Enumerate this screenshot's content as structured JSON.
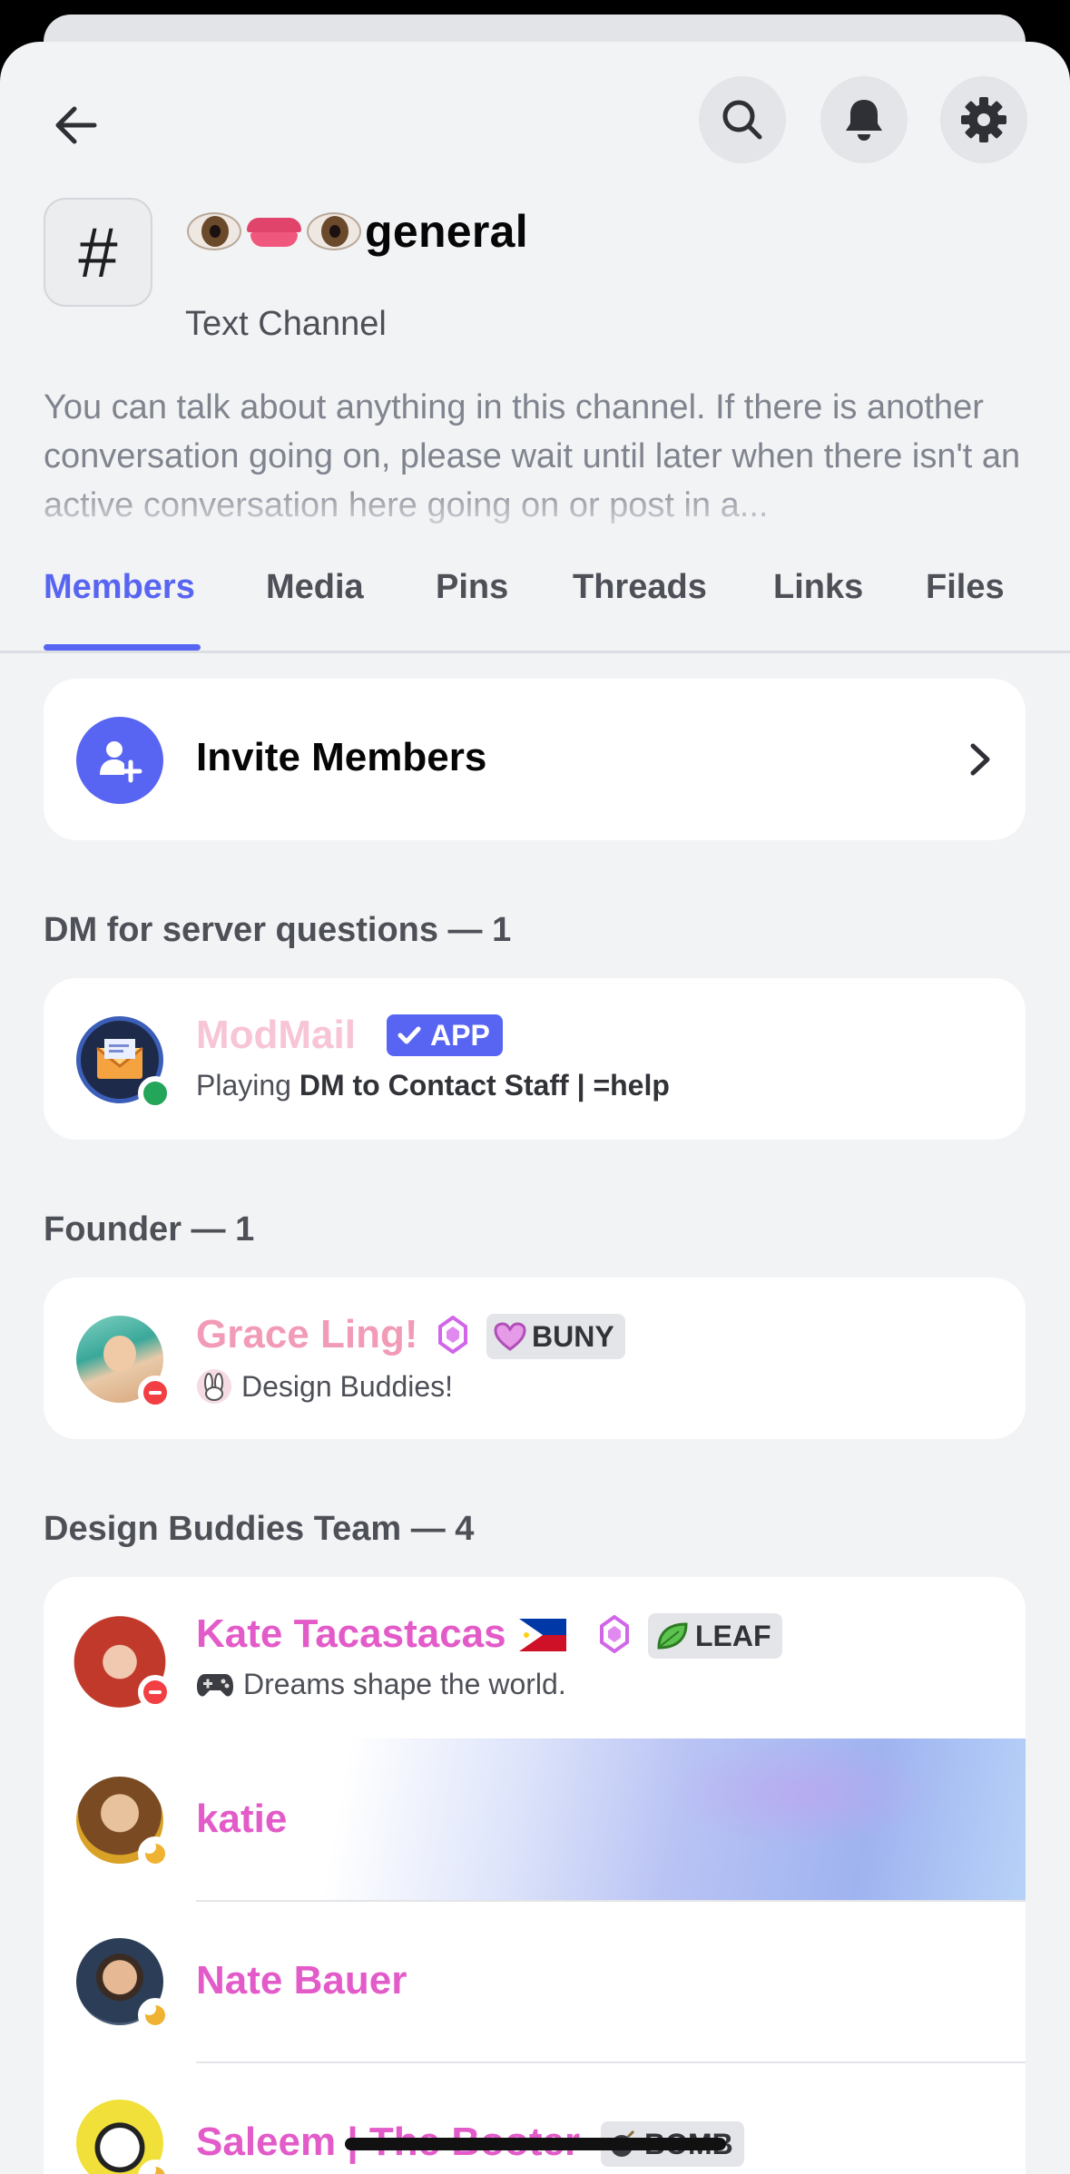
{
  "header": {
    "back_icon": "arrow-left-icon",
    "actions": [
      "search-icon",
      "bell-icon",
      "gear-icon"
    ]
  },
  "channel": {
    "hash_glyph": "#",
    "emoji_prefix": "👁👄👁",
    "name": "general",
    "type": "Text Channel",
    "description": "You can talk about anything in this channel. If there is another conversation going on, please wait until later when there isn't an active conversation here going on or post in a..."
  },
  "tabs": [
    {
      "label": "Members",
      "active": true
    },
    {
      "label": "Media",
      "active": false
    },
    {
      "label": "Pins",
      "active": false
    },
    {
      "label": "Threads",
      "active": false
    },
    {
      "label": "Links",
      "active": false
    },
    {
      "label": "Files",
      "active": false
    }
  ],
  "invite": {
    "label": "Invite Members",
    "icon": "add-user-icon"
  },
  "sections": [
    {
      "title": "DM for server questions — 1",
      "members": [
        {
          "name": "ModMail",
          "name_color": "#f7c5d6",
          "badge": "APP",
          "status": "online",
          "activity_prefix": "Playing ",
          "activity_bold": "DM to Contact Staff | =help"
        }
      ]
    },
    {
      "title": "Founder — 1",
      "members": [
        {
          "name": "Grace Ling!",
          "name_color": "#f29bb7",
          "tag": "BUNY",
          "status": "dnd",
          "activity": "Design Buddies!"
        }
      ]
    },
    {
      "title": "Design Buddies Team — 4",
      "members": [
        {
          "name": "Kate Tacastacas",
          "name_color": "#e35bc9",
          "flag": "🇵🇭",
          "tag": "LEAF",
          "status": "dnd",
          "activity": "Dreams shape the world."
        },
        {
          "name": "katie",
          "name_color": "#e35bc9",
          "status": "idle"
        },
        {
          "name": "Nate Bauer",
          "name_color": "#e35bc9",
          "status": "idle"
        },
        {
          "name": "Saleem | The Booter",
          "name_color": "#e35bc9",
          "tag": "BOMB",
          "status": "idle"
        }
      ]
    }
  ],
  "colors": {
    "accent": "#5865f2",
    "background": "#f2f3f5",
    "card": "#ffffff",
    "online": "#23a55a",
    "dnd": "#f23f43",
    "idle": "#f0b232"
  }
}
